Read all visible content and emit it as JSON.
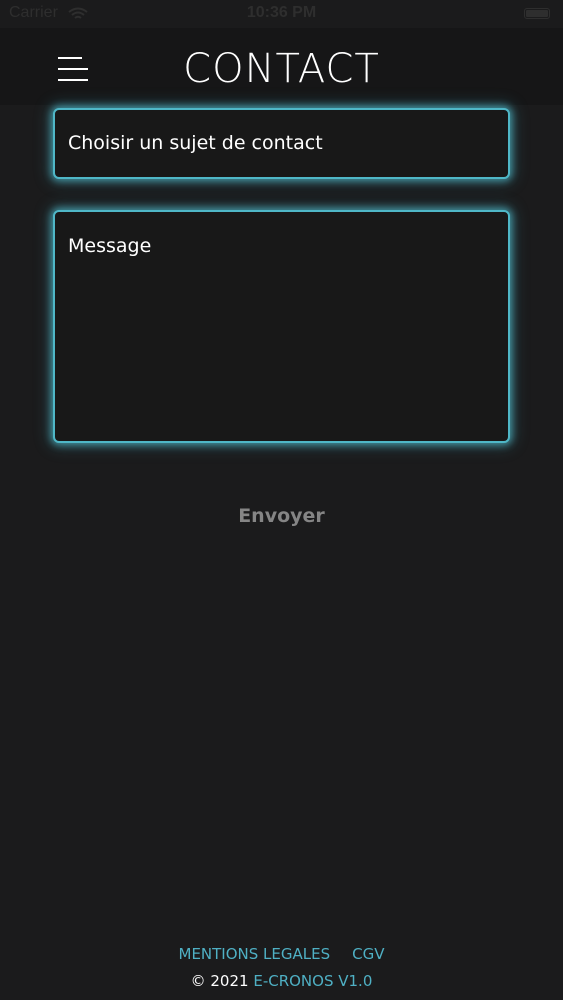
{
  "status_bar": {
    "carrier": "Carrier",
    "time": "10:36 PM",
    "wifi_icon": "wifi-icon",
    "battery_icon": "battery-icon"
  },
  "header": {
    "title": "CONTACT",
    "menu_icon": "hamburger-menu-icon"
  },
  "form": {
    "subject_placeholder": "Choisir un sujet de contact",
    "message_placeholder": "Message",
    "send_label": "Envoyer"
  },
  "footer": {
    "legal_link": "MENTIONS LEGALES",
    "cgv_link": "CGV",
    "copyright_prefix": "© 2021",
    "brand": "E-CRONOS V1.0"
  },
  "colors": {
    "background": "#1b1b1c",
    "header_background": "#161617",
    "accent": "#4fb7c7",
    "send_button_text": "#858585",
    "text": "#ffffff"
  }
}
